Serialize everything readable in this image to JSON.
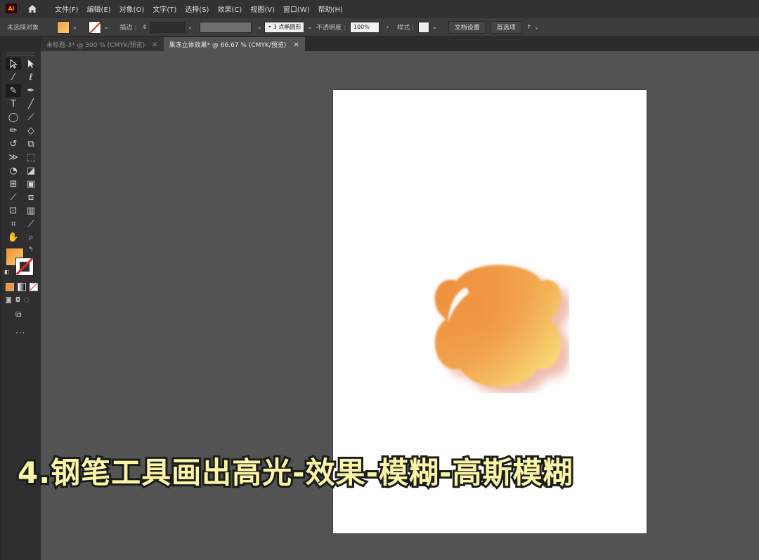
{
  "app": {
    "logo": "Ai"
  },
  "menubar": {
    "items": [
      "文件(F)",
      "编辑(E)",
      "对象(O)",
      "文字(T)",
      "选择(S)",
      "效果(C)",
      "视图(V)",
      "窗口(W)",
      "帮助(H)"
    ]
  },
  "control_bar": {
    "selection_status": "未选择对象",
    "stroke_label": "描边 :",
    "brush_value": "3 点椭圆形",
    "opacity_label": "不透明度 :",
    "opacity_value": "100%",
    "style_label": "样式 :",
    "doc_setup_button": "文档设置",
    "preferences_button": "首选项",
    "fill_color": "#f2a04e",
    "stroke_color": "none"
  },
  "tabs": [
    {
      "label": "未标题-3* @ 300 % (CMYK/预览)",
      "active": false
    },
    {
      "label": "果冻立体效果* @ 66.67 % (CMYK/预览)",
      "active": true
    }
  ],
  "toolbar": {
    "tools": [
      "selection-tool",
      "direct-selection-tool",
      "magic-wand-tool",
      "lasso-tool",
      "curvature-tool",
      "pen-tool",
      "type-tool",
      "line-segment-tool",
      "ellipse-tool",
      "paintbrush-tool",
      "pencil-tool",
      "eraser-tool",
      "rotate-tool",
      "scale-tool",
      "width-tool",
      "free-transform-tool",
      "shape-builder-tool",
      "live-paint-bucket-tool",
      "mesh-tool",
      "gradient-tool",
      "eyedropper-tool",
      "blend-tool",
      "symbol-sprayer-tool",
      "column-graph-tool",
      "artboard-tool",
      "slice-tool",
      "hand-tool",
      "zoom-tool"
    ],
    "fill_color": "#f0913d",
    "stroke_color": "none",
    "more_label": "..."
  },
  "artwork": {
    "shape": "four-lobed jelly flower",
    "gradient_start": "#ef8f3e",
    "gradient_end": "#f8e07a",
    "shadow_color": "#e8b0a4"
  },
  "caption": "4.钢笔工具画出高光-效果-模糊-高斯模糊"
}
